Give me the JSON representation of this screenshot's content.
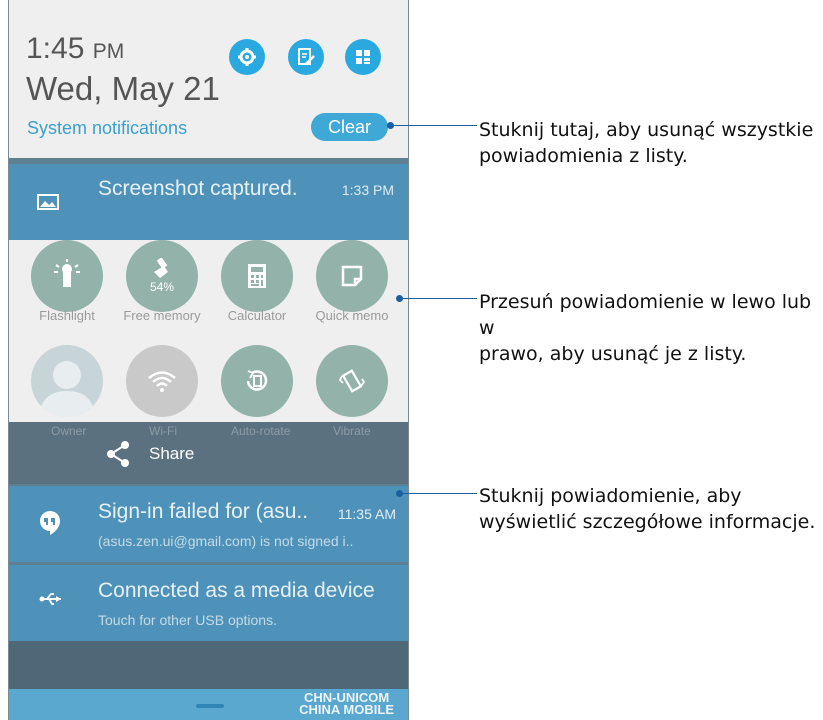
{
  "status": {
    "time": "1:45",
    "ampm": "PM",
    "date": "Wed, May 21",
    "system_notifications": "System notifications",
    "clear": "Clear"
  },
  "header_buttons": [
    {
      "icon": "gear-icon"
    },
    {
      "icon": "edit-icon"
    },
    {
      "icon": "grid-icon"
    }
  ],
  "notifications": [
    {
      "title": "Screenshot captured.",
      "time": "1:33 PM",
      "icon": "image-icon"
    },
    {
      "title": "Sign-in failed for (asu..",
      "time": "11:35 AM",
      "subtitle": "(asus.zen.ui@gmail.com) is not signed i..",
      "icon": "hangouts-icon"
    },
    {
      "title": "Connected as a media device",
      "subtitle": "Touch for other USB options.",
      "icon": "usb-icon"
    }
  ],
  "quick_settings": {
    "row1": [
      {
        "label": "Flashlight",
        "icon": "flashlight-icon"
      },
      {
        "label": "Free memory",
        "icon": "broom-icon",
        "value": "54%"
      },
      {
        "label": "Calculator",
        "icon": "calculator-icon"
      },
      {
        "label": "Quick memo",
        "icon": "memo-icon"
      }
    ],
    "row2": [
      {
        "label": "Owner",
        "icon": "avatar-icon"
      },
      {
        "label": "Wi-Fi",
        "icon": "wifi-icon"
      },
      {
        "label": "Auto-rotate",
        "icon": "rotate-icon"
      },
      {
        "label": "Vibrate",
        "icon": "vibrate-icon"
      }
    ]
  },
  "share": {
    "label": "Share",
    "icon": "share-icon"
  },
  "carrier": {
    "line1": "CHN-UNICOM",
    "line2": "CHINA MOBILE"
  },
  "callouts": [
    {
      "line1": "Stuknij tutaj, aby usunąć wszystkie",
      "line2": "powiadomienia z listy."
    },
    {
      "line1": "Przesuń powiadomienie w lewo lub w",
      "line2": "prawo, aby usunąć je z listy."
    },
    {
      "line1": "Stuknij powiadomienie, aby",
      "line2": "wyświetlić szczegółowe informacje."
    }
  ],
  "colors": {
    "accent": "#29a9df",
    "notification_bg": "#4f92b9",
    "callout": "#1a5fa0"
  }
}
